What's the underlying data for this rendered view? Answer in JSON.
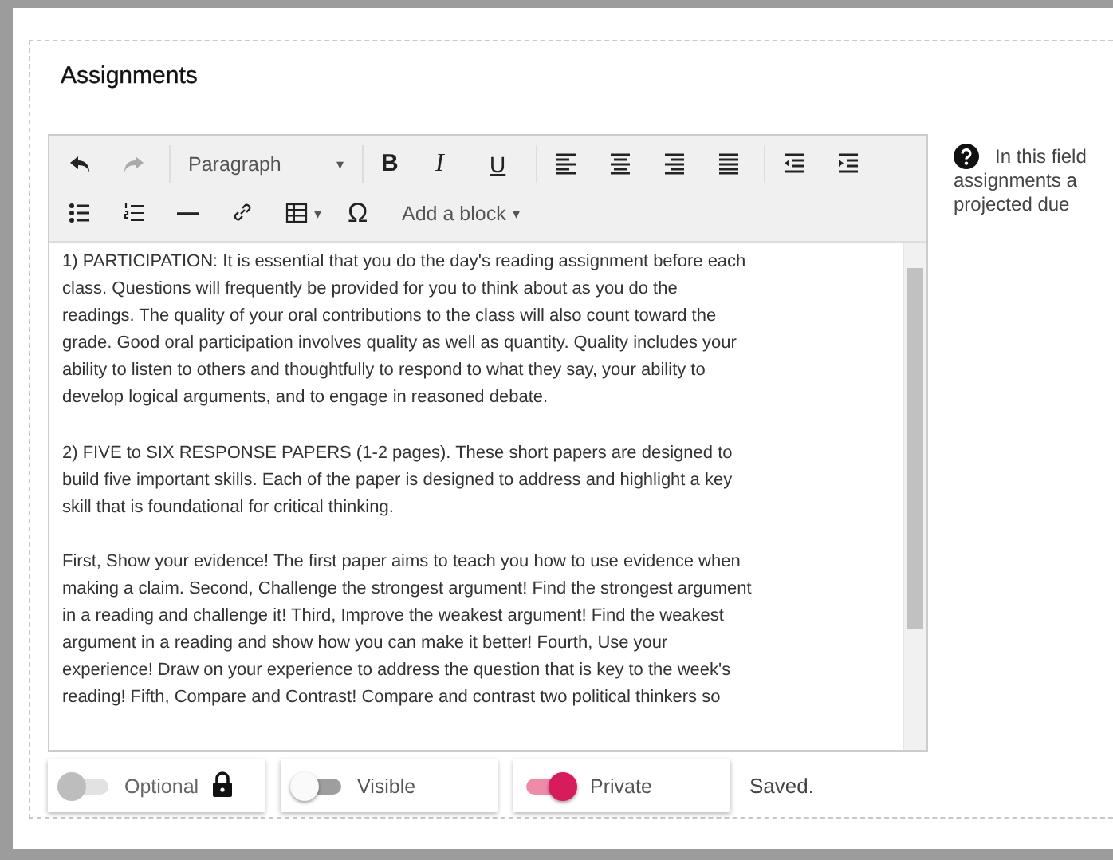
{
  "section": {
    "title": "Assignments"
  },
  "toolbar": {
    "undo": {
      "disabled": false
    },
    "redo": {
      "disabled": true
    },
    "format": {
      "label": "Paragraph",
      "caret": "▾"
    },
    "bold": {
      "label": "B"
    },
    "italic": {
      "label": "I"
    },
    "underline": {
      "label": "U"
    },
    "table": {
      "caret": "▾"
    },
    "special_character": {
      "label": "Ω"
    },
    "add_block": {
      "label": "Add a block",
      "caret": "▾"
    }
  },
  "content": {
    "paragraphs": [
      [
        "1) PARTICIPATION: It is essential that you do the day's reading assignment before each",
        "class. Questions will frequently be provided for you to think about as you do the",
        "readings. The quality of your oral contributions to the class will also count toward the",
        "grade. Good oral participation involves quality as well as quantity. Quality includes your",
        "ability to listen to others and thoughtfully to respond to what they say, your ability to",
        "develop logical arguments, and to engage in reasoned debate."
      ],
      [
        "2) FIVE to SIX RESPONSE PAPERS (1-2 pages). These short papers are designed to",
        "build five important skills. Each of the paper is designed to address and highlight a key",
        "skill that is foundational for critical thinking."
      ],
      [
        "First, Show your evidence! The first paper aims to teach you how to use evidence when",
        "making a claim. Second, Challenge the strongest argument! Find the strongest argument",
        "in a reading and challenge it! Third, Improve the weakest argument! Find the weakest",
        "argument in a reading and show how you can make it better! Fourth, Use your",
        "experience! Draw on your experience to address the question that is key to the week's",
        "reading! Fifth, Compare and Contrast! Compare and contrast two political thinkers so"
      ]
    ]
  },
  "toggles": [
    {
      "label": "Optional",
      "on": false,
      "disabled": true,
      "locked": true
    },
    {
      "label": "Visible",
      "on": false,
      "disabled": false,
      "locked": false
    },
    {
      "label": "Private",
      "on": true,
      "disabled": false,
      "locked": false
    }
  ],
  "status": "Saved.",
  "help": {
    "lines": [
      "In this field",
      "assignments a",
      "projected due"
    ]
  }
}
